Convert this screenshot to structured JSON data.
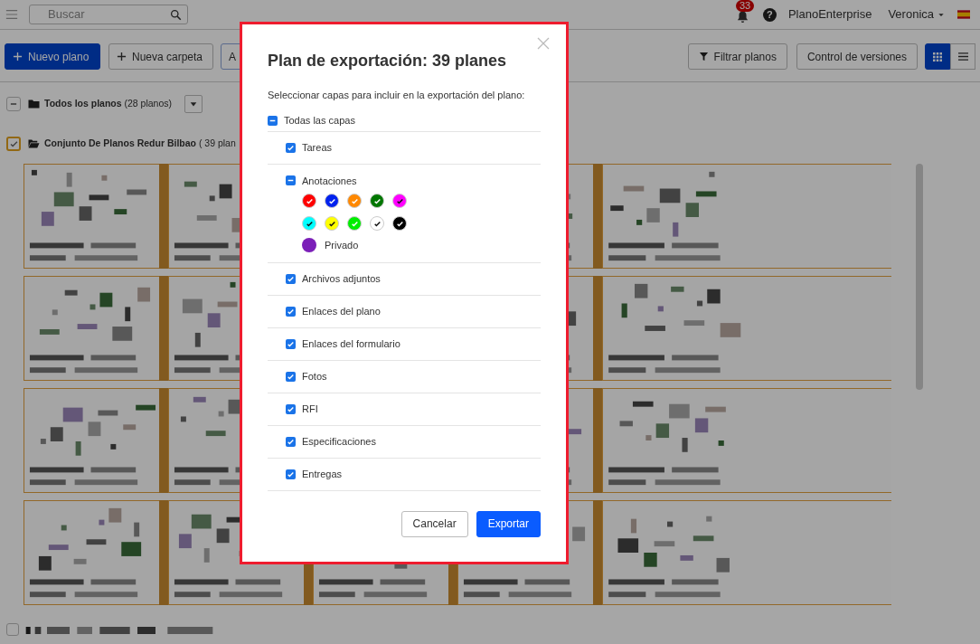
{
  "topbar": {
    "search": {
      "placeholder": "Buscar"
    },
    "notifications": "33",
    "help": "?",
    "account": "PlanoEnterprise",
    "user": "Veronica"
  },
  "toolbar": {
    "left_buttons": [
      {
        "label": "Nuevo plano",
        "kind": "primary"
      },
      {
        "label": "Nueva carpeta",
        "kind": "add"
      },
      {
        "label": "A",
        "kind": "outline"
      }
    ],
    "right_buttons": [
      {
        "label": "Filtrar planos",
        "kind": "filter"
      },
      {
        "label": "Control de versiones",
        "kind": "plain"
      }
    ],
    "view_toggle": [
      {
        "kind": "grid",
        "selected": true
      },
      {
        "kind": "list",
        "selected": false
      }
    ]
  },
  "folders": [
    {
      "kind": "closed",
      "name": "Todos los planos",
      "count": "(28 planos)",
      "checked": false,
      "indeterminate": true
    },
    {
      "kind": "open",
      "name": "Conjunto De Planos Redur Bilbao",
      "count": "( 39 plan",
      "checked": true
    }
  ],
  "bottom_row": {
    "checked": false
  },
  "modal": {
    "title": "Plan de exportación: 39 planes",
    "prompt": "Seleccionar capas para incluir en la exportación del plano:",
    "all_layers": {
      "label": "Todas las capas",
      "checked": false,
      "indeterminate": true
    },
    "layers": [
      {
        "kind": "simple",
        "label": "Tareas",
        "checked": true
      },
      {
        "kind": "annotations",
        "label": "Anotaciones",
        "checked": false,
        "indeterminate": true,
        "colors": [
          {
            "color": "#ff0000",
            "checked": true
          },
          {
            "color": "#0022ee",
            "checked": true
          },
          {
            "color": "#ff8800",
            "checked": true
          },
          {
            "color": "#007700",
            "checked": true
          },
          {
            "color": "#ff00ff",
            "checked": true
          },
          {
            "color": "#00ffff",
            "checked": true
          },
          {
            "color": "#ffff00",
            "checked": true
          },
          {
            "color": "#00ee00",
            "checked": true
          },
          {
            "color": "#ffffff",
            "checked": true
          },
          {
            "color": "#000000",
            "checked": true
          }
        ],
        "private": {
          "label": "Privado",
          "color": "#7b1fb8",
          "checked": false
        }
      },
      {
        "kind": "simple",
        "label": "Archivos adjuntos",
        "checked": true
      },
      {
        "kind": "simple",
        "label": "Enlaces del plano",
        "checked": true
      },
      {
        "kind": "simple",
        "label": "Enlaces del formulario",
        "checked": true
      },
      {
        "kind": "simple",
        "label": "Fotos",
        "checked": true
      },
      {
        "kind": "simple",
        "label": "RFI",
        "checked": true
      },
      {
        "kind": "simple",
        "label": "Especificaciones",
        "checked": true
      },
      {
        "kind": "simple",
        "label": "Entregas",
        "checked": true
      }
    ],
    "buttons": [
      {
        "label": "Cancelar",
        "kind": "secondary"
      },
      {
        "label": "Exportar",
        "kind": "primary"
      }
    ]
  }
}
